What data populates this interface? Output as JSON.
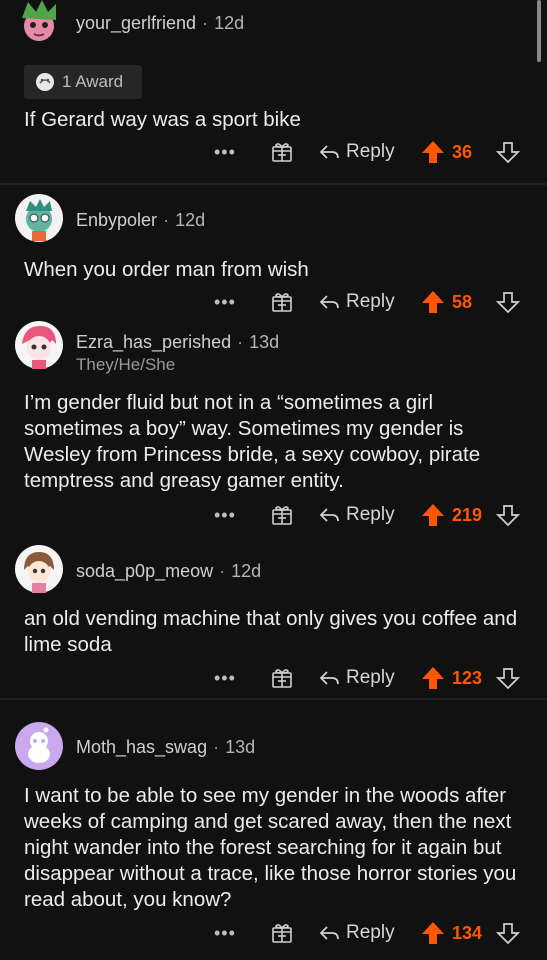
{
  "comments": [
    {
      "username": "your_gerlfriend",
      "age": "12d",
      "award": "1 Award",
      "body": "If Gerard way was a sport bike",
      "score": "36",
      "reply_label": "Reply",
      "more": "•••"
    },
    {
      "username": "Enbypoler",
      "age": "12d",
      "body": "When you order man from wish",
      "score": "58",
      "reply_label": "Reply",
      "more": "•••"
    },
    {
      "username": "Ezra_has_perished",
      "age": "13d",
      "flair": "They/He/She",
      "body": "I’m gender fluid but not in a “sometimes a girl sometimes a boy” way. Sometimes my gender is Wesley from Princess bride, a sexy cowboy, pirate temptress and greasy gamer entity.",
      "score": "219",
      "reply_label": "Reply",
      "more": "•••"
    },
    {
      "username": "soda_p0p_meow",
      "age": "12d",
      "body": "an old vending machine that only gives you coffee and  lime soda",
      "score": "123",
      "reply_label": "Reply",
      "more": "•••"
    },
    {
      "username": "Moth_has_swag",
      "age": "13d",
      "body": "I want to be able to see my gender in the woods after weeks of camping and get scared away, then the next night wander into the forest searching for it again but disappear without a trace, like those horror stories you read about, you know?",
      "score": "134",
      "reply_label": "Reply",
      "more": "•••"
    }
  ],
  "colors": {
    "background": "#111111",
    "upvote_accent": "#ff5700",
    "text": "#ececec",
    "meta": "#b5b5b5"
  },
  "icons": [
    "avatar",
    "award-icon",
    "more-options-icon",
    "gift-icon",
    "reply-arrow-icon",
    "upvote-icon",
    "downvote-icon"
  ]
}
